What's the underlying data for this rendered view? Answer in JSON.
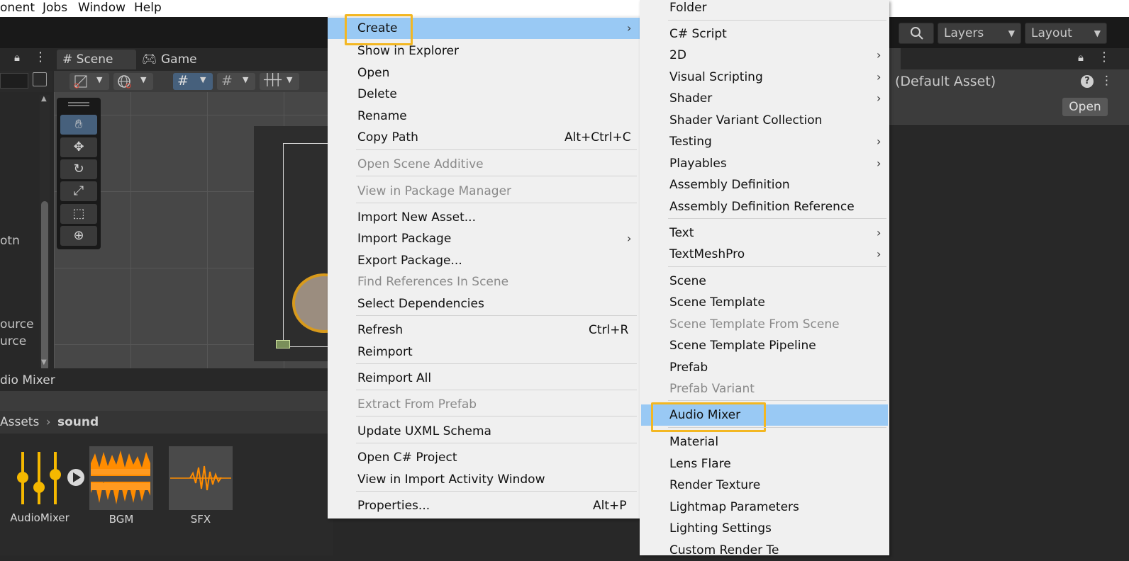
{
  "menubar": {
    "items": [
      "onent",
      "Jobs",
      "Window",
      "Help"
    ]
  },
  "toolbar": {
    "search_icon": "search-icon",
    "layers_label": "Layers",
    "layout_label": "Layout"
  },
  "scene_panel": {
    "tabs": [
      "Scene",
      "Game"
    ],
    "hierarchy_fragments": [
      "otn",
      "ource",
      "urce"
    ]
  },
  "bottom_panel": {
    "title": "dio Mixer",
    "breadcrumb": [
      "Assets",
      "sound"
    ],
    "assets": [
      {
        "label": "AudioMixer",
        "icon": "audio-mixer-icon"
      },
      {
        "label": "BGM",
        "icon": "audio-waveform-icon"
      },
      {
        "label": "SFX",
        "icon": "audio-waveform-icon"
      }
    ]
  },
  "inspector": {
    "title": "(Default Asset)",
    "open_button": "Open"
  },
  "context_menu": {
    "items": [
      {
        "label": "Create",
        "submenu": true,
        "highlighted": true
      },
      {
        "label": "Show in Explorer"
      },
      {
        "label": "Open"
      },
      {
        "label": "Delete"
      },
      {
        "label": "Rename"
      },
      {
        "label": "Copy Path",
        "shortcut": "Alt+Ctrl+C"
      },
      {
        "label": "Open Scene Additive",
        "disabled": true
      },
      {
        "label": "View in Package Manager",
        "disabled": true
      },
      {
        "label": "Import New Asset..."
      },
      {
        "label": "Import Package",
        "submenu": true
      },
      {
        "label": "Export Package..."
      },
      {
        "label": "Find References In Scene",
        "disabled": true
      },
      {
        "label": "Select Dependencies"
      },
      {
        "label": "Refresh",
        "shortcut": "Ctrl+R"
      },
      {
        "label": "Reimport"
      },
      {
        "label": "Reimport All"
      },
      {
        "label": "Extract From Prefab",
        "disabled": true
      },
      {
        "label": "Update UXML Schema"
      },
      {
        "label": "Open C# Project"
      },
      {
        "label": "View in Import Activity Window"
      },
      {
        "label": "Properties...",
        "shortcut": "Alt+P"
      }
    ]
  },
  "create_submenu": {
    "items": [
      {
        "label": "Folder"
      },
      {
        "label": "C# Script"
      },
      {
        "label": "2D",
        "submenu": true
      },
      {
        "label": "Visual Scripting",
        "submenu": true
      },
      {
        "label": "Shader",
        "submenu": true
      },
      {
        "label": "Shader Variant Collection"
      },
      {
        "label": "Testing",
        "submenu": true
      },
      {
        "label": "Playables",
        "submenu": true
      },
      {
        "label": "Assembly Definition"
      },
      {
        "label": "Assembly Definition Reference"
      },
      {
        "label": "Text",
        "submenu": true
      },
      {
        "label": "TextMeshPro",
        "submenu": true
      },
      {
        "label": "Scene"
      },
      {
        "label": "Scene Template"
      },
      {
        "label": "Scene Template From Scene",
        "disabled": true
      },
      {
        "label": "Scene Template Pipeline"
      },
      {
        "label": "Prefab"
      },
      {
        "label": "Prefab Variant",
        "disabled": true
      },
      {
        "label": "Audio Mixer",
        "highlighted": true
      },
      {
        "label": "Material"
      },
      {
        "label": "Lens Flare"
      },
      {
        "label": "Render Texture"
      },
      {
        "label": "Lightmap Parameters"
      },
      {
        "label": "Lighting Settings"
      },
      {
        "label": "Custom Render Te"
      }
    ]
  },
  "colors": {
    "highlight": "#99c9f4",
    "focus_outline": "#f3b722",
    "menu_bg": "#f0f0f0",
    "asset_orange": "#ff8c00",
    "mixer_yellow": "#f5b800"
  }
}
